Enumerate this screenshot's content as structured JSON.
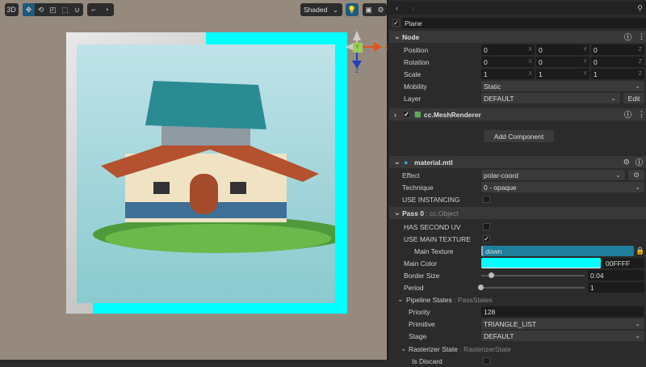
{
  "toolbar": {
    "btn_3d": "3D",
    "shading": "Shaded"
  },
  "gizmo": {
    "x": "X",
    "y": "Y",
    "z": "Z"
  },
  "inspector": {
    "node_name": "Plane",
    "node": {
      "title": "Node",
      "position": {
        "label": "Position",
        "x": "0",
        "y": "0",
        "z": "0"
      },
      "rotation": {
        "label": "Rotation",
        "x": "0",
        "y": "0",
        "z": "0"
      },
      "scale": {
        "label": "Scale",
        "x": "1",
        "y": "1",
        "z": "1"
      },
      "mobility": {
        "label": "Mobility",
        "value": "Static"
      },
      "layer": {
        "label": "Layer",
        "value": "DEFAULT",
        "edit": "Edit"
      }
    },
    "mesh_renderer": "cc.MeshRenderer",
    "add_component": "Add Component",
    "material": {
      "title": "material.mtl",
      "effect": {
        "label": "Effect",
        "value": "polar-coord"
      },
      "technique": {
        "label": "Technique",
        "value": "0 - opaque"
      },
      "use_instancing": "USE INSTANCING"
    },
    "pass": {
      "title": "Pass 0",
      "type": ": cc.Object",
      "has_second_uv": "HAS SECOND UV",
      "use_main_texture": "USE MAIN TEXTURE",
      "main_texture": {
        "label": "Main Texture",
        "value": "down"
      },
      "main_color": {
        "label": "Main Color",
        "value": "00FFFF",
        "color": "#00ffff"
      },
      "border_size": {
        "label": "Border Size",
        "value": "0.04"
      },
      "period": {
        "label": "Period",
        "value": "1"
      }
    },
    "pipeline": {
      "title": "Pipeline States",
      "type": ": PassStates",
      "priority": {
        "label": "Priority",
        "value": "128"
      },
      "primitive": {
        "label": "Primitive",
        "value": "TRIANGLE_LIST"
      },
      "stage": {
        "label": "Stage",
        "value": "DEFAULT"
      }
    },
    "rasterizer": {
      "title": "Rasterizer State",
      "type": ": RasterizerState",
      "is_discard": "Is Discard"
    }
  }
}
